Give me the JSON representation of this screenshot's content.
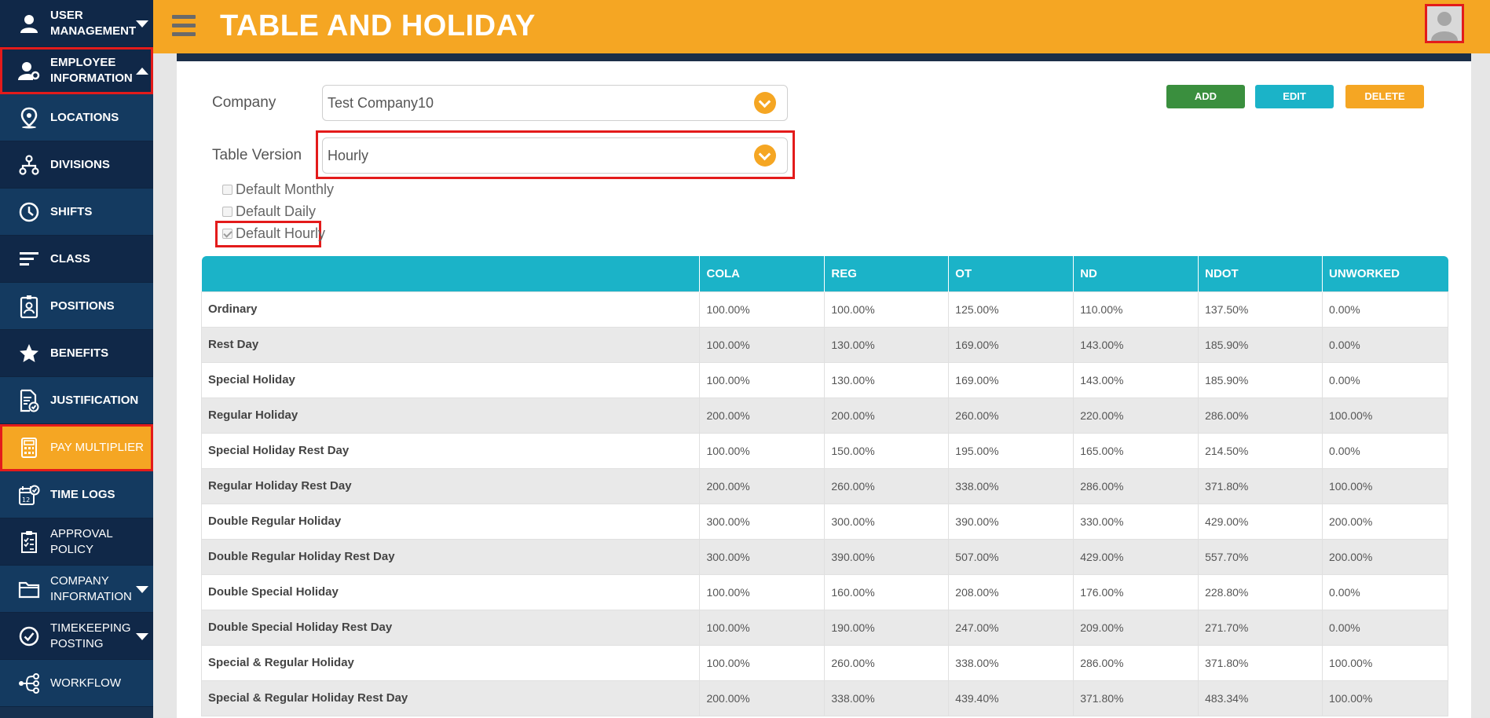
{
  "sidebar": {
    "items": [
      {
        "label_line1": "USER",
        "label_line2": "MANAGEMENT",
        "icon": "user-icon"
      },
      {
        "label_line1": "EMPLOYEE",
        "label_line2": "INFORMATION",
        "icon": "employee-gear-icon"
      },
      {
        "label": "LOCATIONS",
        "icon": "location-pin-icon"
      },
      {
        "label": "DIVISIONS",
        "icon": "hierarchy-icon"
      },
      {
        "label": "SHIFTS",
        "icon": "clock-icon"
      },
      {
        "label": "CLASS",
        "icon": "lines-icon"
      },
      {
        "label": "POSITIONS",
        "icon": "id-badge-icon"
      },
      {
        "label": "BENEFITS",
        "icon": "star-icon"
      },
      {
        "label": "JUSTIFICATION",
        "icon": "document-check-icon"
      },
      {
        "label": "PAY MULTIPLIER",
        "icon": "calculator-icon"
      },
      {
        "label": "TIME LOGS",
        "icon": "calendar-check-icon"
      },
      {
        "label_line1": "APPROVAL",
        "label_line2": "POLICY",
        "icon": "approval-list-icon"
      },
      {
        "label_line1": "COMPANY",
        "label_line2": "INFORMATION",
        "icon": "folder-icon"
      },
      {
        "label_line1": "TIMEKEEPING",
        "label_line2": "POSTING",
        "icon": "check-circle-icon"
      },
      {
        "label": "WORKFLOW",
        "icon": "workflow-icon"
      }
    ]
  },
  "header": {
    "title": "TABLE AND HOLIDAY"
  },
  "form": {
    "company_label": "Company",
    "company_value": "Test Company10",
    "table_version_label": "Table Version",
    "table_version_value": "Hourly",
    "checkboxes": [
      {
        "label": "Default Monthly",
        "checked": false
      },
      {
        "label": "Default Daily",
        "checked": false
      },
      {
        "label": "Default Hourly",
        "checked": true
      }
    ]
  },
  "actions": {
    "add": "ADD",
    "edit": "EDIT",
    "delete": "DELETE"
  },
  "colors": {
    "accent": "#f5a623",
    "sidebar": "#16304f",
    "table_header": "#1bb3c8",
    "add": "#3a8f3e",
    "edit": "#1bb3c8",
    "delete": "#f5a623"
  },
  "table": {
    "headers": [
      "",
      "COLA",
      "REG",
      "OT",
      "ND",
      "NDOT",
      "UNWORKED"
    ],
    "rows": [
      [
        "Ordinary",
        "100.00%",
        "100.00%",
        "125.00%",
        "110.00%",
        "137.50%",
        "0.00%"
      ],
      [
        "Rest Day",
        "100.00%",
        "130.00%",
        "169.00%",
        "143.00%",
        "185.90%",
        "0.00%"
      ],
      [
        "Special Holiday",
        "100.00%",
        "130.00%",
        "169.00%",
        "143.00%",
        "185.90%",
        "0.00%"
      ],
      [
        "Regular Holiday",
        "200.00%",
        "200.00%",
        "260.00%",
        "220.00%",
        "286.00%",
        "100.00%"
      ],
      [
        "Special Holiday Rest Day",
        "100.00%",
        "150.00%",
        "195.00%",
        "165.00%",
        "214.50%",
        "0.00%"
      ],
      [
        "Regular Holiday Rest Day",
        "200.00%",
        "260.00%",
        "338.00%",
        "286.00%",
        "371.80%",
        "100.00%"
      ],
      [
        "Double Regular Holiday",
        "300.00%",
        "300.00%",
        "390.00%",
        "330.00%",
        "429.00%",
        "200.00%"
      ],
      [
        "Double Regular Holiday Rest Day",
        "300.00%",
        "390.00%",
        "507.00%",
        "429.00%",
        "557.70%",
        "200.00%"
      ],
      [
        "Double Special Holiday",
        "100.00%",
        "160.00%",
        "208.00%",
        "176.00%",
        "228.80%",
        "0.00%"
      ],
      [
        "Double Special Holiday Rest Day",
        "100.00%",
        "190.00%",
        "247.00%",
        "209.00%",
        "271.70%",
        "0.00%"
      ],
      [
        "Special & Regular Holiday",
        "100.00%",
        "260.00%",
        "338.00%",
        "286.00%",
        "371.80%",
        "100.00%"
      ],
      [
        "Special & Regular Holiday Rest Day",
        "200.00%",
        "338.00%",
        "439.40%",
        "371.80%",
        "483.34%",
        "100.00%"
      ]
    ]
  }
}
